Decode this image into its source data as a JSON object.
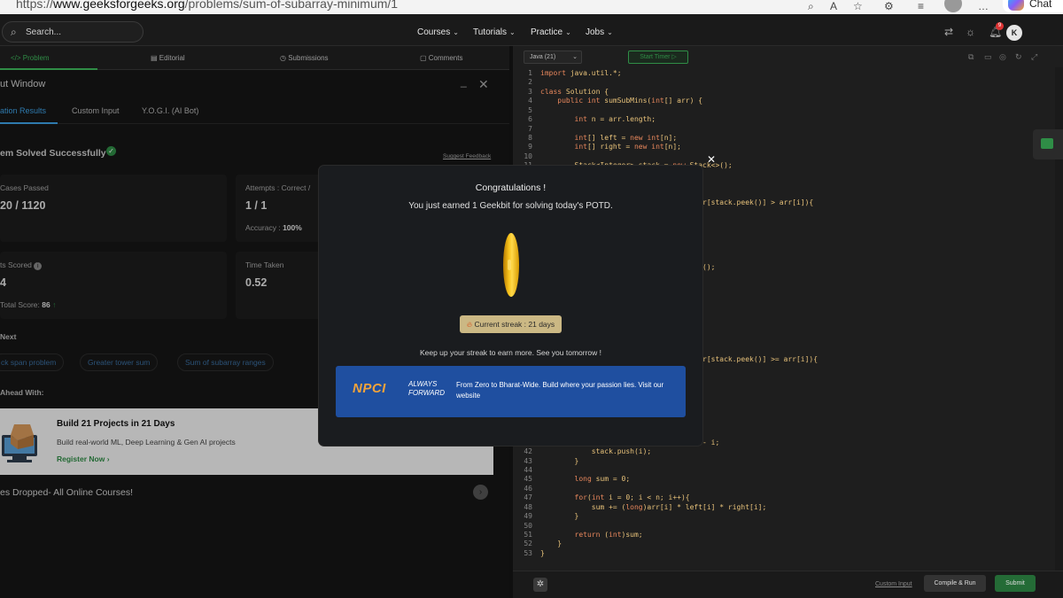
{
  "browser": {
    "url_prefix": "https://",
    "url_domain": "www.geeksforgeeks.org",
    "url_path": "/problems/sum-of-subarray-minimum/1",
    "chat_label": "Chat"
  },
  "nav": {
    "search_placeholder": "Search...",
    "items": [
      "Courses",
      "Tutorials",
      "Practice",
      "Jobs"
    ],
    "notification_count": "9",
    "user_initial": "K"
  },
  "left_tabs": [
    "Problem",
    "Editorial",
    "Submissions",
    "Comments"
  ],
  "output_window": {
    "title": "ut Window",
    "tabs": [
      "ation Results",
      "Custom Input",
      "Y.O.G.I. (AI Bot)"
    ],
    "solved_text": "em Solved Successfully",
    "suggest_feedback": "Suggest Feedback",
    "cards": {
      "test_cases_label": "Cases Passed",
      "test_cases_value": "20 / 1120",
      "attempts_label": "Attempts : Correct /",
      "attempts_value": "1 / 1",
      "accuracy_label": "Accuracy :",
      "accuracy_value": "100%",
      "points_label": "ts Scored",
      "points_value": "4",
      "total_score_label": "Total Score:",
      "total_score_value": "86",
      "time_label": "Time Taken",
      "time_value": "0.52"
    },
    "next_label": "Next",
    "next_problems": [
      "ck span problem",
      "Greater tower sum",
      "Sum of subarray ranges"
    ],
    "ahead_label": "Ahead With:",
    "promo": {
      "title": "Build 21 Projects in 21 Days",
      "desc": "Build real-world ML, Deep Learning & Gen AI projects",
      "cta": "Register Now"
    },
    "dropped_text": "es Dropped- All Online Courses!"
  },
  "editor": {
    "language": "Java (21)",
    "timer_label": "Start Timer",
    "custom_input": "Custom Input",
    "compile_label": "Compile & Run",
    "submit_label": "Submit",
    "lines": [
      {
        "n": "1",
        "t": "import java.util.*;"
      },
      {
        "n": "2",
        "t": ""
      },
      {
        "n": "3",
        "t": "class Solution {"
      },
      {
        "n": "4",
        "t": "    public int sumSubMins(int[] arr) {"
      },
      {
        "n": "5",
        "t": ""
      },
      {
        "n": "6",
        "t": "        int n = arr.length;"
      },
      {
        "n": "7",
        "t": ""
      },
      {
        "n": "8",
        "t": "        int[] left = new int[n];"
      },
      {
        "n": "9",
        "t": "        int[] right = new int[n];"
      },
      {
        "n": "10",
        "t": ""
      },
      {
        "n": "11",
        "t": "        Stack<Integer> stack = new Stack<>();"
      },
      {
        "n": "",
        "t": ""
      },
      {
        "n": "",
        "t": ""
      },
      {
        "n": "",
        "t": ""
      },
      {
        "n": "",
        "t": "                                    arr[stack.peek()] > arr[i]){"
      },
      {
        "n": "",
        "t": ""
      },
      {
        "n": "",
        "t": ""
      },
      {
        "n": "",
        "t": ""
      },
      {
        "n": "",
        "t": ""
      },
      {
        "n": "",
        "t": ""
      },
      {
        "n": "",
        "t": ""
      },
      {
        "n": "",
        "t": "                                    ek();"
      },
      {
        "n": "",
        "t": ""
      },
      {
        "n": "",
        "t": ""
      },
      {
        "n": "",
        "t": ""
      },
      {
        "n": "",
        "t": ""
      },
      {
        "n": "",
        "t": ""
      },
      {
        "n": "",
        "t": ""
      },
      {
        "n": "",
        "t": ""
      },
      {
        "n": "",
        "t": "                                    ){"
      },
      {
        "n": "",
        "t": ""
      },
      {
        "n": "",
        "t": "                                    arr[stack.peek()] >= arr[i]){"
      },
      {
        "n": "",
        "t": ""
      },
      {
        "n": "",
        "t": ""
      },
      {
        "n": "",
        "t": ""
      },
      {
        "n": "",
        "t": ""
      },
      {
        "n": "",
        "t": ""
      },
      {
        "n": "",
        "t": ""
      },
      {
        "n": "",
        "t": ""
      },
      {
        "n": "",
        "t": ""
      },
      {
        "n": "41",
        "t": "                                    ) - i;"
      },
      {
        "n": "42",
        "t": "            stack.push(i);"
      },
      {
        "n": "43",
        "t": "        }"
      },
      {
        "n": "44",
        "t": ""
      },
      {
        "n": "45",
        "t": "        long sum = 0;"
      },
      {
        "n": "46",
        "t": ""
      },
      {
        "n": "47",
        "t": "        for(int i = 0; i < n; i++){"
      },
      {
        "n": "48",
        "t": "            sum += (long)arr[i] * left[i] * right[i];"
      },
      {
        "n": "49",
        "t": "        }"
      },
      {
        "n": "50",
        "t": ""
      },
      {
        "n": "51",
        "t": "        return (int)sum;"
      },
      {
        "n": "52",
        "t": "    }"
      },
      {
        "n": "53",
        "t": "}"
      }
    ]
  },
  "modal": {
    "title": "Congratulations !",
    "subtitle": "You just earned 1 Geekbit for solving today's POTD.",
    "streak": "Current streak : 21 days",
    "keep_up": "Keep up your streak to earn more. See you tomorrow !",
    "ad_logo": "NPCI",
    "ad_tagline_1": "ALWAYS",
    "ad_tagline_2": "FORWARD",
    "ad_text": "From Zero to Bharat-Wide. Build where your passion lies. Visit our website"
  }
}
